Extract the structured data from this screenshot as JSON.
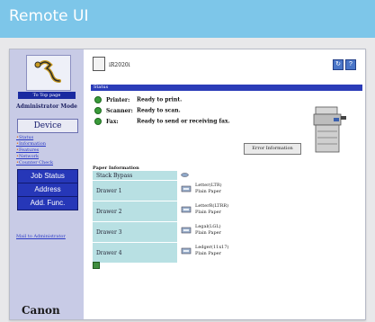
{
  "title_bar": {
    "title": "Remote UI"
  },
  "sidebar": {
    "badge": "To Top page",
    "mode": "Administrator Mode",
    "device_button": "Device",
    "sub_items": [
      "Status",
      "Information",
      "Features",
      "Network",
      "Counter Check"
    ],
    "buttons": [
      "Job Status",
      "Address",
      "Add. Func."
    ],
    "help_link": "Mail to Administrator",
    "brand": "Canon"
  },
  "main": {
    "model": "iR2020i",
    "top_buttons": [
      "?"
    ],
    "status_heading": "Status",
    "status": [
      {
        "label": "Printer:",
        "value": "Ready to print."
      },
      {
        "label": "Scanner:",
        "value": "Ready to scan."
      },
      {
        "label": "Fax:",
        "value": "Ready to send or receiving fax."
      }
    ],
    "error_button": "Error Information",
    "paper_heading": "Paper Information",
    "paper": [
      {
        "source": "Stack Bypass",
        "lines": []
      },
      {
        "source": "Drawer 1",
        "lines": [
          "Letter(LTR)",
          "Plain Paper"
        ]
      },
      {
        "source": "Drawer 2",
        "lines": [
          "LetterR(LTRR)",
          "Plain Paper"
        ]
      },
      {
        "source": "Drawer 3",
        "lines": [
          "Legal(LGL)",
          "Plain Paper"
        ]
      },
      {
        "source": "Drawer 4",
        "lines": [
          "Ledger(11x17)",
          "Plain Paper"
        ]
      }
    ]
  },
  "colors": {
    "title_bar": "#7dc6e9",
    "sidebar": "#c8cbe6",
    "nav_button": "#2637b8",
    "section_bar": "#2b3cb8",
    "paper_cell": "#b8e0e3",
    "status_ok": "#3a9a3a"
  },
  "icons": [
    "wrench-logo-icon",
    "printer-icon",
    "refresh-icon",
    "help-icon",
    "paper-tray-icon",
    "status-light-icon",
    "copier-image"
  ]
}
